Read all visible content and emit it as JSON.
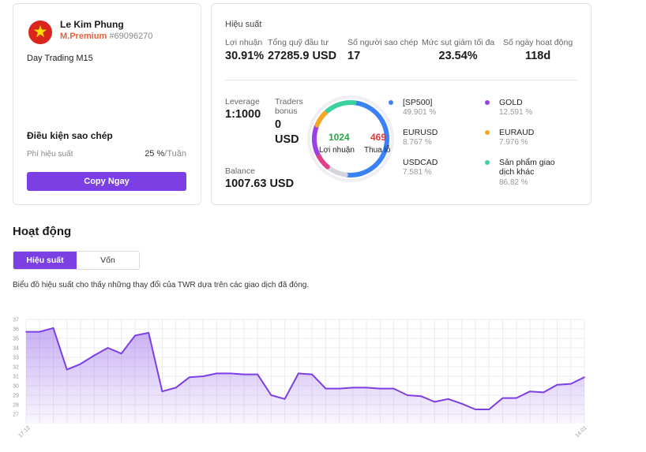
{
  "profile": {
    "name": "Le Kim Phung",
    "tier": "M.Premium",
    "account_id": "#69096270",
    "flag_icon": "vietnam-flag-icon",
    "strategy": "Day Trading M15",
    "copy_conditions_title": "Điều kiện sao chép",
    "fee_label": "Phí hiệu suất",
    "fee_value": "25 %",
    "fee_unit": "/Tuần",
    "copy_button": "Copy Ngay"
  },
  "performance": {
    "title": "Hiệu suất",
    "stats": [
      {
        "label": "Lợi nhuận",
        "value": "30.91%"
      },
      {
        "label": "Tổng quỹ đầu tư",
        "value": "27285.9 USD"
      },
      {
        "label": "Số người sao chép",
        "value": "17"
      },
      {
        "label": "Mức sụt giảm tối đa",
        "value": "23.54%"
      },
      {
        "label": "Số ngày hoạt động",
        "value": "118d"
      }
    ],
    "leverage_label": "Leverage",
    "leverage_value": "1:1000",
    "traders_bonus_label": "Traders bonus",
    "traders_bonus_value": "0 USD",
    "balance_label": "Balance",
    "balance_value": "1007.63 USD",
    "wins": "1024",
    "wins_label": "Lợi nhuận",
    "losses": "469",
    "losses_label": "Thua lỗ",
    "donut_segments": [
      {
        "color": "#3b82f6",
        "fraction": 0.499
      },
      {
        "color": "#d4d4dc",
        "fraction": 0.088
      },
      {
        "color": "#e0408a",
        "fraction": 0.076
      },
      {
        "color": "#9b3fe6",
        "fraction": 0.126
      },
      {
        "color": "#f5a623",
        "fraction": 0.08
      },
      {
        "color": "#3ad29f",
        "fraction": 0.131
      }
    ],
    "legend": [
      {
        "name": "[SP500]",
        "pct": "49.901 %",
        "color": "#3b82f6"
      },
      {
        "name": "GOLD",
        "pct": "12.591 %",
        "color": "#9b3fe6"
      },
      {
        "name": "EURUSD",
        "pct": "8.767 %",
        "color": ""
      },
      {
        "name": "EURAUD",
        "pct": "7.976 %",
        "color": "#f5a623"
      },
      {
        "name": "USDCAD",
        "pct": "7.581 %",
        "color": ""
      },
      {
        "name": "Sản phẩm giao dịch khác",
        "pct": "86.82 %",
        "color": "#3ad29f"
      }
    ]
  },
  "activity": {
    "title": "Hoạt động",
    "tabs": [
      {
        "label": "Hiệu suất",
        "active": true
      },
      {
        "label": "Vốn",
        "active": false
      }
    ],
    "description": "Biểu đồ hiệu suất cho thấy những thay đổi của TWR dựa trên các giao dịch đã đóng."
  },
  "chart_data": {
    "type": "area",
    "title": "",
    "xlabel": "",
    "ylabel": "",
    "ylim": [
      26,
      37
    ],
    "yticks": [
      27,
      28,
      29,
      30,
      31,
      32,
      33,
      34,
      35,
      36,
      37
    ],
    "x_tick_labels": [
      "17.12",
      "14.01"
    ],
    "grid": true,
    "color": "#7b3fe4",
    "series": [
      {
        "values": [
          35.7,
          35.7,
          36.1,
          31.7,
          32.3,
          33.2,
          34.0,
          33.4,
          35.3,
          35.6,
          29.4,
          29.8,
          30.9,
          31.0,
          31.3,
          31.3,
          31.2,
          31.2,
          29.0,
          28.6,
          31.3,
          31.2,
          29.7,
          29.7,
          29.8,
          29.8,
          29.7,
          29.7,
          29.0,
          28.9,
          28.3,
          28.6,
          28.1,
          27.5,
          27.5,
          28.7,
          28.7,
          29.4,
          29.3,
          30.1,
          30.2,
          30.9
        ]
      }
    ]
  }
}
